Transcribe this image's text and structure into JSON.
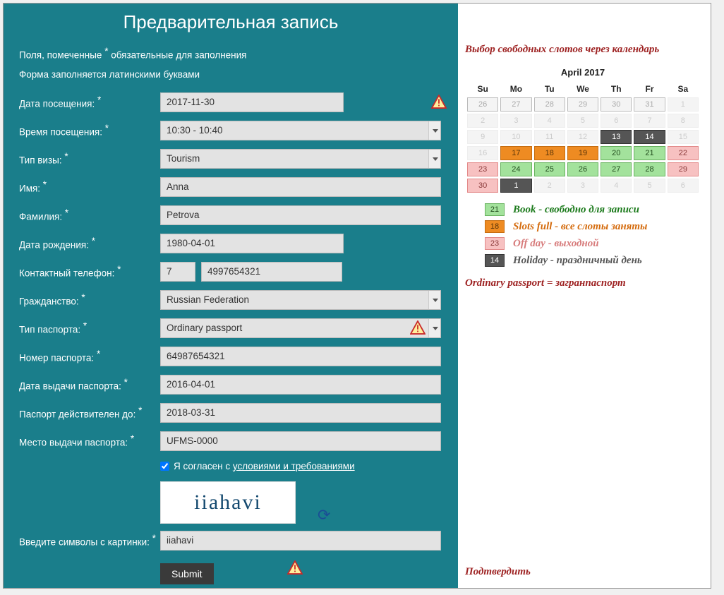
{
  "title": "Предварительная запись",
  "hint1_a": "Поля, помеченные ",
  "hint1_b": " обязательные для заполнения",
  "hint2": "Форма заполняется латинскими буквами",
  "star": "*",
  "labels": {
    "date": "Дата посещения: ",
    "time": "Время посещения: ",
    "visa": "Тип визы: ",
    "name": "Имя: ",
    "surname": "Фамилия: ",
    "dob": "Дата рождения: ",
    "phone": "Контактный телефон: ",
    "citizen": "Гражданство: ",
    "ptype": "Тип паспорта: ",
    "pnum": "Номер паспорта: ",
    "pissue": "Дата выдачи паспорта: ",
    "pvalid": "Паспорт действителен до: ",
    "pplace": "Место выдачи паспорта: ",
    "captcha": "Введите символы с картинки: "
  },
  "values": {
    "date": "2017-11-30",
    "time": "10:30 - 10:40",
    "visa": "Tourism",
    "name": "Anna",
    "surname": "Petrova",
    "dob": "1980-04-01",
    "phone_cc": "7",
    "phone": "4997654321",
    "citizen": "Russian Federation",
    "ptype": "Ordinary passport",
    "pnum": "64987654321",
    "pissue": "2016-04-01",
    "pvalid": "2018-03-31",
    "pplace": "UFMS-0000",
    "captcha_img": "iiahavi",
    "captcha_input": "iiahavi"
  },
  "consent": {
    "pre": "Я согласен с ",
    "link": "условиями и требованиями"
  },
  "submit": "Submit",
  "right": {
    "anno1": "Выбор свободных слотов через календарь",
    "cal_title": "April 2017",
    "days": [
      "Su",
      "Mo",
      "Tu",
      "We",
      "Th",
      "Fr",
      "Sa"
    ],
    "weeks": [
      [
        {
          "n": "26",
          "c": "muted"
        },
        {
          "n": "27",
          "c": "muted"
        },
        {
          "n": "28",
          "c": "muted"
        },
        {
          "n": "29",
          "c": "muted"
        },
        {
          "n": "30",
          "c": "muted"
        },
        {
          "n": "31",
          "c": "muted"
        },
        {
          "n": "1",
          "c": "empty"
        }
      ],
      [
        {
          "n": "2",
          "c": "empty"
        },
        {
          "n": "3",
          "c": "empty"
        },
        {
          "n": "4",
          "c": "empty"
        },
        {
          "n": "5",
          "c": "empty"
        },
        {
          "n": "6",
          "c": "empty"
        },
        {
          "n": "7",
          "c": "empty"
        },
        {
          "n": "8",
          "c": "empty"
        }
      ],
      [
        {
          "n": "9",
          "c": "empty"
        },
        {
          "n": "10",
          "c": "empty"
        },
        {
          "n": "11",
          "c": "empty"
        },
        {
          "n": "12",
          "c": "empty"
        },
        {
          "n": "13",
          "c": "hol"
        },
        {
          "n": "14",
          "c": "hol"
        },
        {
          "n": "15",
          "c": "empty"
        }
      ],
      [
        {
          "n": "16",
          "c": "empty"
        },
        {
          "n": "17",
          "c": "full"
        },
        {
          "n": "18",
          "c": "full"
        },
        {
          "n": "19",
          "c": "full"
        },
        {
          "n": "20",
          "c": "book"
        },
        {
          "n": "21",
          "c": "book"
        },
        {
          "n": "22",
          "c": "off"
        }
      ],
      [
        {
          "n": "23",
          "c": "off"
        },
        {
          "n": "24",
          "c": "book"
        },
        {
          "n": "25",
          "c": "book"
        },
        {
          "n": "26",
          "c": "book"
        },
        {
          "n": "27",
          "c": "book"
        },
        {
          "n": "28",
          "c": "book"
        },
        {
          "n": "29",
          "c": "off"
        }
      ],
      [
        {
          "n": "30",
          "c": "off"
        },
        {
          "n": "1",
          "c": "hol"
        },
        {
          "n": "2",
          "c": "empty"
        },
        {
          "n": "3",
          "c": "empty"
        },
        {
          "n": "4",
          "c": "empty"
        },
        {
          "n": "5",
          "c": "empty"
        },
        {
          "n": "6",
          "c": "empty"
        }
      ]
    ],
    "legend": {
      "book": {
        "num": "21",
        "text": "Book - свободно для записи"
      },
      "full": {
        "num": "18",
        "text": "Slots full - все слоты заняты"
      },
      "off": {
        "num": "23",
        "text": "Off day - выходной"
      },
      "hol": {
        "num": "14",
        "text": "Holiday - праздничный день"
      }
    },
    "passport_note": "Ordinary passport = загранпаспорт",
    "submit_note": "Подтвердить"
  }
}
